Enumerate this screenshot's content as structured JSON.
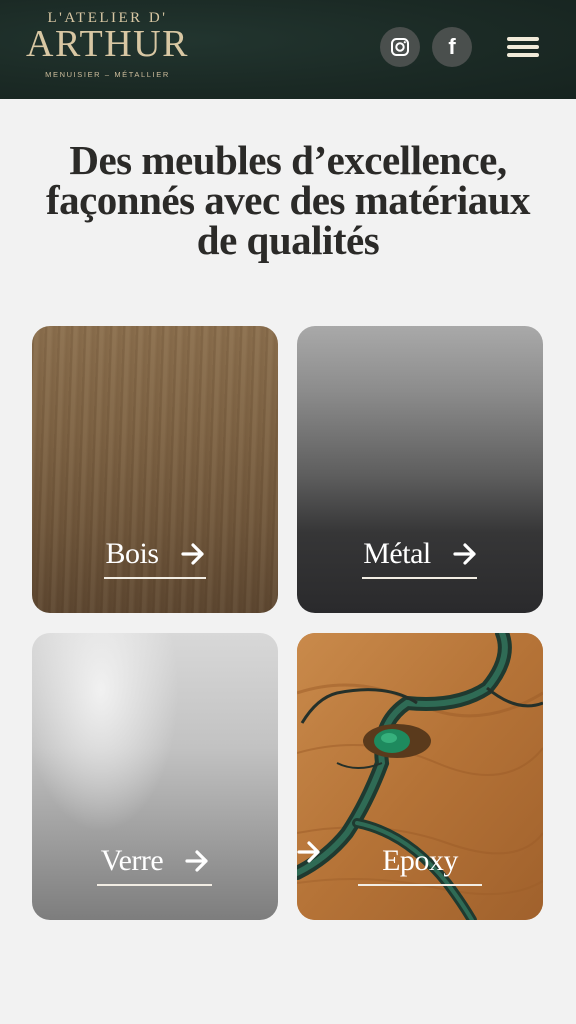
{
  "header": {
    "logo_top": "L'ATELIER D'",
    "logo_main": "ARTHUR",
    "logo_sub": "MENUISIER – MÉTALLIER",
    "social_icons": [
      "instagram-icon",
      "facebook-icon"
    ],
    "facebook_letter": "f",
    "menu_icon": "hamburger-menu-icon"
  },
  "main": {
    "heading": "Des meubles d’excellence, façonnés avec des matériaux de qualités"
  },
  "materials": [
    {
      "label": "Bois"
    },
    {
      "label": "Métal"
    },
    {
      "label": "Verre"
    },
    {
      "label": "Epoxy"
    }
  ],
  "colors": {
    "header_bg": "#1b2a25",
    "logo_gold": "#d8c7a3",
    "page_bg": "#f2f2f2",
    "heading_text": "#2b2a28"
  }
}
